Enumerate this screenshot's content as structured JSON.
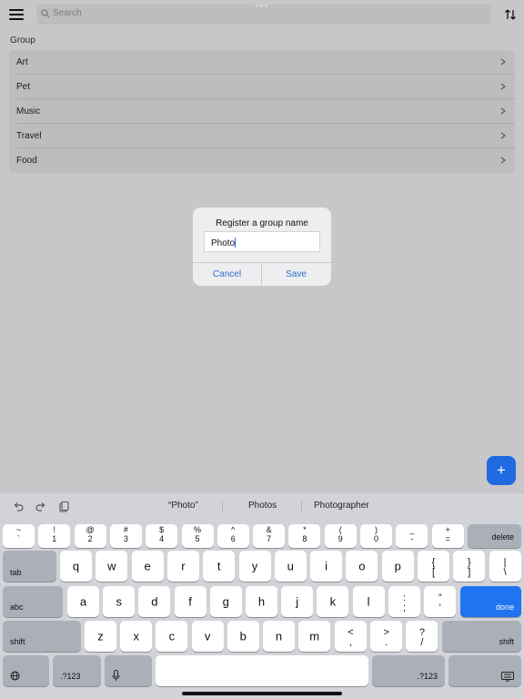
{
  "topbar": {
    "search_placeholder": "Search",
    "menu_icon": "hamburger-menu-icon",
    "sort_icon": "sort-arrows-icon"
  },
  "group": {
    "section_label": "Group",
    "items": [
      {
        "label": "Art"
      },
      {
        "label": "Pet"
      },
      {
        "label": "Music"
      },
      {
        "label": "Travel"
      },
      {
        "label": "Food"
      }
    ]
  },
  "dialog": {
    "title": "Register a group name",
    "input_value": "Photo",
    "cancel_label": "Cancel",
    "save_label": "Save"
  },
  "fab": {
    "label": "+"
  },
  "keyboard": {
    "suggestions": [
      "“Photo”",
      "Photos",
      "Photographer"
    ],
    "row1": [
      {
        "top": "~",
        "bot": "`"
      },
      {
        "top": "!",
        "bot": "1"
      },
      {
        "top": "@",
        "bot": "2"
      },
      {
        "top": "#",
        "bot": "3"
      },
      {
        "top": "$",
        "bot": "4"
      },
      {
        "top": "%",
        "bot": "5"
      },
      {
        "top": "^",
        "bot": "6"
      },
      {
        "top": "&",
        "bot": "7"
      },
      {
        "top": "*",
        "bot": "8"
      },
      {
        "top": "(",
        "bot": "9"
      },
      {
        "top": ")",
        "bot": "0"
      },
      {
        "top": "_",
        "bot": "-"
      },
      {
        "top": "+",
        "bot": "="
      }
    ],
    "row2": [
      "q",
      "w",
      "e",
      "r",
      "t",
      "y",
      "u",
      "i",
      "o",
      "p"
    ],
    "row2_extra": [
      {
        "top": "{",
        "bot": "["
      },
      {
        "top": "}",
        "bot": "]"
      },
      {
        "top": "|",
        "bot": "\\"
      }
    ],
    "row3": [
      "a",
      "s",
      "d",
      "f",
      "g",
      "h",
      "j",
      "k",
      "l"
    ],
    "row3_extra": [
      {
        "top": ":",
        "bot": ";"
      },
      {
        "top": "”",
        "bot": "’"
      }
    ],
    "row4": [
      "z",
      "x",
      "c",
      "v",
      "b",
      "n",
      "m"
    ],
    "row4_extra": [
      {
        "top": "<",
        "bot": ","
      },
      {
        "top": ">",
        "bot": "."
      },
      {
        "top": "?",
        "bot": "/"
      }
    ],
    "delete_label": "delete",
    "tab_label": "tab",
    "abc_label": "abc",
    "done_label": "done",
    "shift_label": "shift",
    "num_label": ".?123",
    "accent_color": "#1f74f0"
  }
}
